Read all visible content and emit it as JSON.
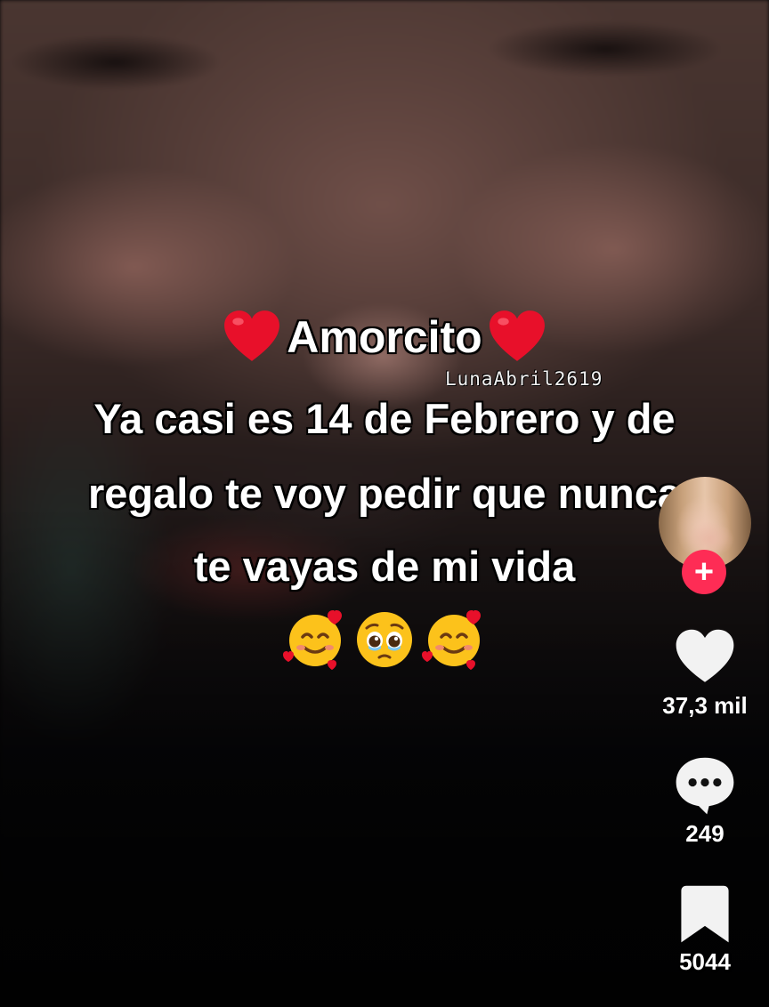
{
  "video": {
    "caption": {
      "title": "Amorcito",
      "line1": "Ya casi es 14 de Febrero y de",
      "line2": "regalo te voy pedir que nunca",
      "line3": "te vayas de mi vida",
      "emojis": [
        "smiling-face-with-hearts",
        "pleading-face",
        "smiling-face-with-hearts"
      ]
    },
    "watermark": "LunaAbril2619"
  },
  "rail": {
    "likes": "37,3 mil",
    "comments": "249",
    "saves": "5044",
    "follow_symbol": "+"
  },
  "colors": {
    "follow": "#fe2c55",
    "heart_emoji": "#e8102a",
    "icon": "#ffffff"
  },
  "icons": {
    "like": "heart-icon",
    "comment": "comment-bubble-icon",
    "bookmark": "bookmark-icon"
  }
}
